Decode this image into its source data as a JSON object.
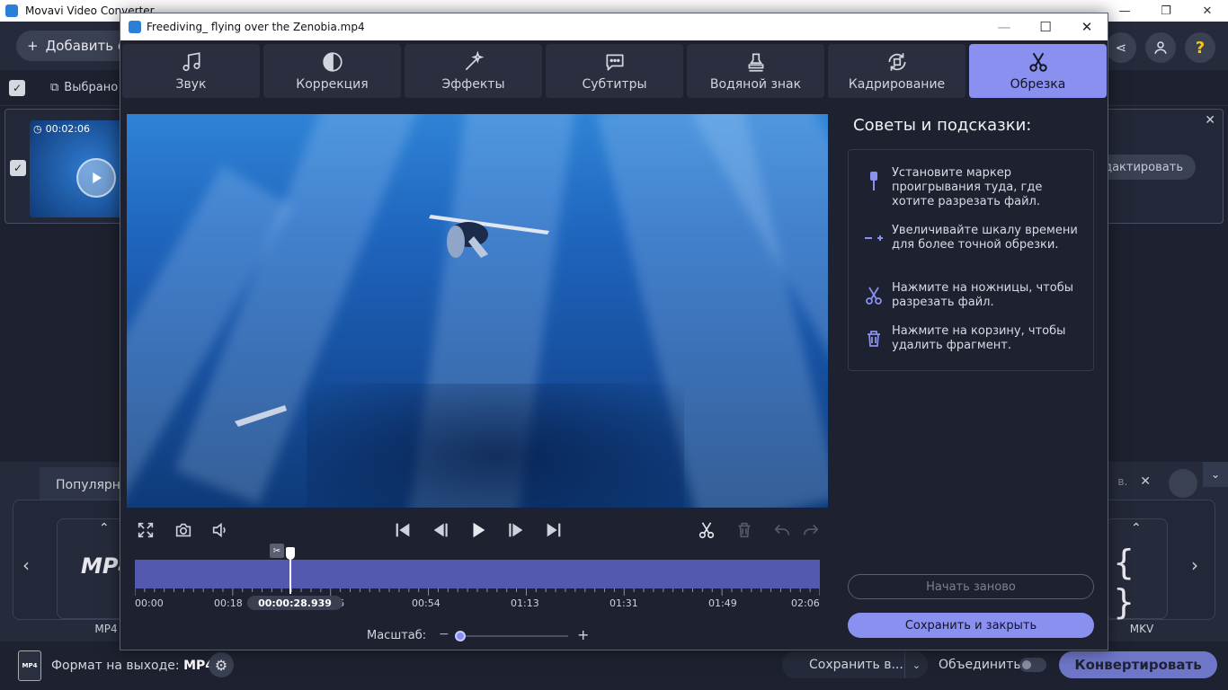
{
  "app": {
    "title": "Movavi Video Converter",
    "add_button_label": "Добавить ф",
    "selected_label": "Выбрано",
    "file": {
      "duration": "00:02:06",
      "edit_label": "дактировать"
    },
    "formats": {
      "tab_popular": "Популярны",
      "search_stub": "в.",
      "left_format_label": "MP4",
      "right_format_label": "MKV",
      "left_tile_text": "MP4"
    },
    "bottom": {
      "output_format_label": "Формат на выходе:",
      "output_format_value": "MP4",
      "output_icon_text": "MP4",
      "save_to_label": "Сохранить в...",
      "merge_label": "Объединить:",
      "convert_label": "Конвертировать"
    }
  },
  "editor": {
    "window_title": "Freediving_ flying over the Zenobia.mp4",
    "tabs": [
      {
        "label": "Звук",
        "icon": "music-note-icon"
      },
      {
        "label": "Коррекция",
        "icon": "contrast-icon"
      },
      {
        "label": "Эффекты",
        "icon": "magic-wand-icon"
      },
      {
        "label": "Субтитры",
        "icon": "speech-bubble-icon"
      },
      {
        "label": "Водяной знак",
        "icon": "stamp-icon"
      },
      {
        "label": "Кадрирование",
        "icon": "crop-rotate-icon"
      },
      {
        "label": "Обрезка",
        "icon": "scissors-icon",
        "active": true
      }
    ],
    "timeline": {
      "labels": [
        "00:00",
        "00:18",
        "00:54",
        "01:13",
        "01:31",
        "01:49",
        "02:06"
      ],
      "current_time": "00:00:28.939",
      "current_time_tail": "6",
      "zoom_label": "Масштаб:",
      "zoom_minus": "−",
      "zoom_plus": "+",
      "scissor_tag": "✂"
    },
    "tips": {
      "title": "Советы и подсказки:",
      "items": [
        {
          "icon": "playhead-marker-icon",
          "text": "Установите маркер проигрывания туда, где хотите разрезать файл."
        },
        {
          "icon": "zoom-scale-icon",
          "text": "Увеличивайте шкалу времени для более точной обрезки."
        },
        {
          "icon": "scissors-icon",
          "text": "Нажмите на ножницы, чтобы разрезать файл."
        },
        {
          "icon": "trash-icon",
          "text": "Нажмите на корзину, чтобы удалить фрагмент."
        }
      ]
    },
    "buttons": {
      "restart": "Начать заново",
      "save_close": "Сохранить и закрыть"
    }
  }
}
